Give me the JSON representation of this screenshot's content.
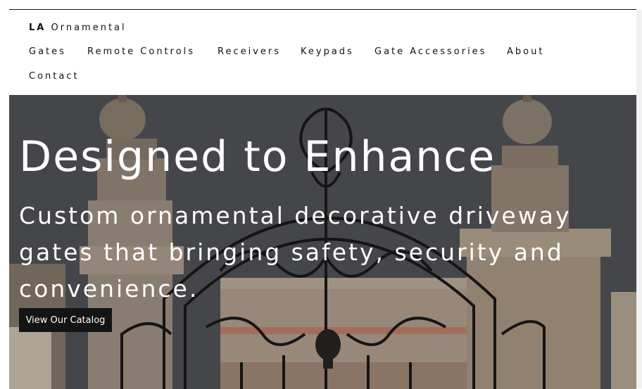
{
  "brand": {
    "strong": "LA",
    "rest": "Ornamental"
  },
  "nav": {
    "items": [
      {
        "label": "Gates"
      },
      {
        "label": "Remote Controls"
      },
      {
        "label": "Receivers"
      },
      {
        "label": "Keypads"
      },
      {
        "label": "Gate Accessories"
      },
      {
        "label": "About"
      },
      {
        "label": "Contact"
      }
    ]
  },
  "hero": {
    "title": "Designed to Enhance",
    "subtitle": "Custom ornamental decorative driveway gates that bringing safety, security and convenience.",
    "cta_label": "View Our Catalog"
  }
}
